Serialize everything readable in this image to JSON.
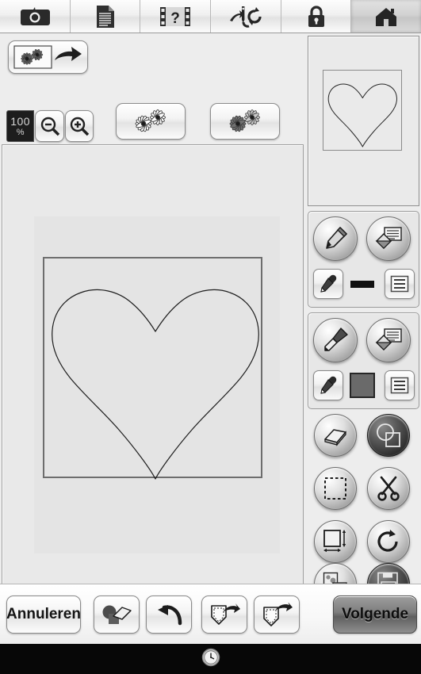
{
  "app": {
    "title": "Embroidery Design Editor",
    "language": "nl"
  },
  "topbar": {
    "items": [
      {
        "name": "camera-icon",
        "label": "Camera",
        "active": false
      },
      {
        "name": "document-icon",
        "label": "Document",
        "active": false
      },
      {
        "name": "help-video-icon",
        "label": "Help",
        "active": false
      },
      {
        "name": "needle-sync-icon",
        "label": "Naald",
        "active": false
      },
      {
        "name": "lock-icon",
        "label": "Vergrendelen",
        "active": false
      },
      {
        "name": "home-icon",
        "label": "Home",
        "active": true
      }
    ]
  },
  "toolrow": {
    "convert_label": "Omzetten",
    "zoom": {
      "value": "100",
      "unit": "%",
      "zoom_out_label": "Uitzoomen",
      "zoom_in_label": "Inzoomen"
    },
    "previews": [
      {
        "name": "flower-outline-preview",
        "label": "Omtrek"
      },
      {
        "name": "flower-filled-preview",
        "label": "Gevuld"
      }
    ]
  },
  "canvas": {
    "design_name": "Hart",
    "shape": "heart-outline",
    "frame_label": "Ontwerpkader"
  },
  "preview": {
    "label": "Voorbeeld",
    "shape": "heart-outline"
  },
  "line_group": {
    "label": "Lijn",
    "draw_label": "Lijn tekenen",
    "fill_label": "Lijngebied vullen",
    "eyedropper_label": "Pipet",
    "swatch_color": "#111111",
    "style_label": "Lijnstijl"
  },
  "fill_group": {
    "label": "Vulling",
    "draw_label": "Vullen tekenen",
    "fill_label": "Gebied vullen",
    "eyedropper_label": "Pipet",
    "swatch_color": "#6a6a6a",
    "style_label": "Vulstijl"
  },
  "grid_tools": [
    {
      "name": "eraser-tool",
      "label": "Gum",
      "selected": false
    },
    {
      "name": "overlap-tool",
      "label": "Overlappen",
      "selected": true
    },
    {
      "name": "select-tool",
      "label": "Selecteren",
      "selected": false
    },
    {
      "name": "scissors-tool",
      "label": "Knippen",
      "selected": false
    },
    {
      "name": "resize-tool",
      "label": "Formaat",
      "selected": false
    },
    {
      "name": "rotate-tool",
      "label": "Draaien",
      "selected": false
    },
    {
      "name": "duplicate-tool",
      "label": "Dupliceren",
      "selected": false
    },
    {
      "name": "save-image-tool",
      "label": "Opslaan",
      "selected": true
    }
  ],
  "bottombar": {
    "cancel_label": "Annuleren",
    "next_label": "Volgende",
    "clear_label": "Wissen",
    "undo_label": "Ongedaan maken",
    "pocket1_label": "Opslaan in geheugen",
    "pocket2_label": "Ophalen uit geheugen"
  },
  "statusbar": {
    "clock_icon": "clock-icon",
    "time_label": ""
  },
  "colors": {
    "panel_bg": "#ededed",
    "canvas_bg": "#e9e9e9",
    "frame_stroke": "#6d6d6d",
    "accent_dark": "#1c1c1c",
    "status_bg": "#070707"
  }
}
